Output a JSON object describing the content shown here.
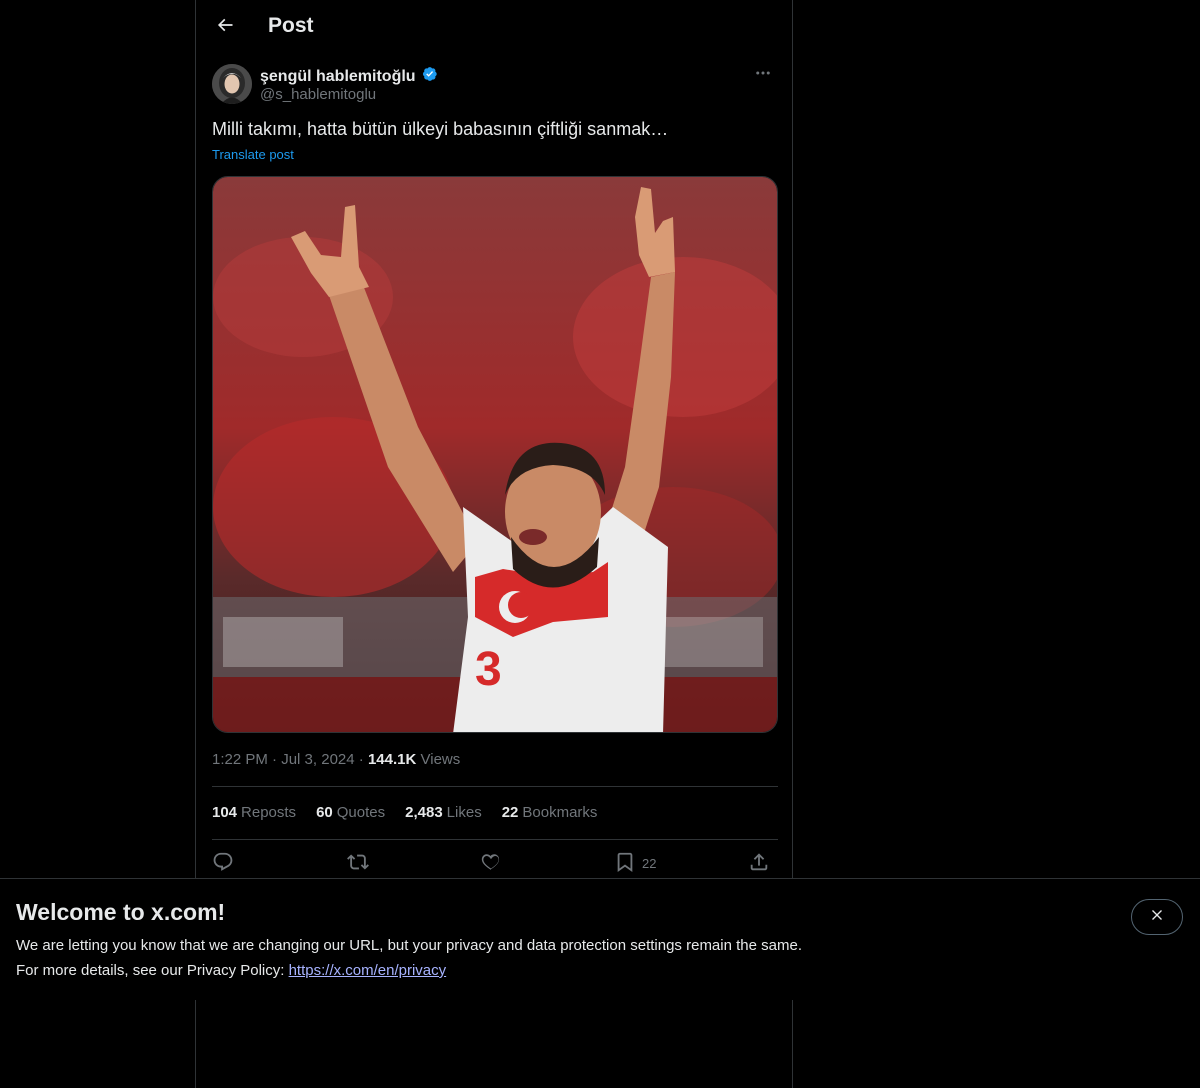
{
  "header": {
    "title": "Post"
  },
  "author": {
    "display_name": "şengül hablemitoğlu",
    "handle": "@s_hablemitoglu",
    "verified": true,
    "verified_color": "#1d9bf0"
  },
  "post": {
    "text": "Milli takımı, hatta bütün ülkeyi babasının çiftliği sanmak…",
    "translate_label": "Translate post",
    "time": "1:22 PM",
    "date": "Jul 3, 2024",
    "views_count": "144.1K",
    "views_label": "Views"
  },
  "stats": [
    {
      "count": "104",
      "label": "Reposts"
    },
    {
      "count": "60",
      "label": "Quotes"
    },
    {
      "count": "2,483",
      "label": "Likes"
    },
    {
      "count": "22",
      "label": "Bookmarks"
    }
  ],
  "actions": {
    "reply_icon": "reply-icon",
    "repost_icon": "repost-icon",
    "like_icon": "heart-icon",
    "bookmark_icon": "bookmark-icon",
    "bookmark_count": "22",
    "share_icon": "share-icon"
  },
  "banner": {
    "title": "Welcome to x.com!",
    "line1": "We are letting you know that we are changing our URL, but your privacy and data protection settings remain the same.",
    "line2_prefix": "For more details, see our Privacy Policy: ",
    "link": "https://x.com/en/privacy"
  },
  "colors": {
    "background": "#000000",
    "accent": "#1d9bf0",
    "muted_text": "#71767b",
    "divider": "#2f3336"
  }
}
